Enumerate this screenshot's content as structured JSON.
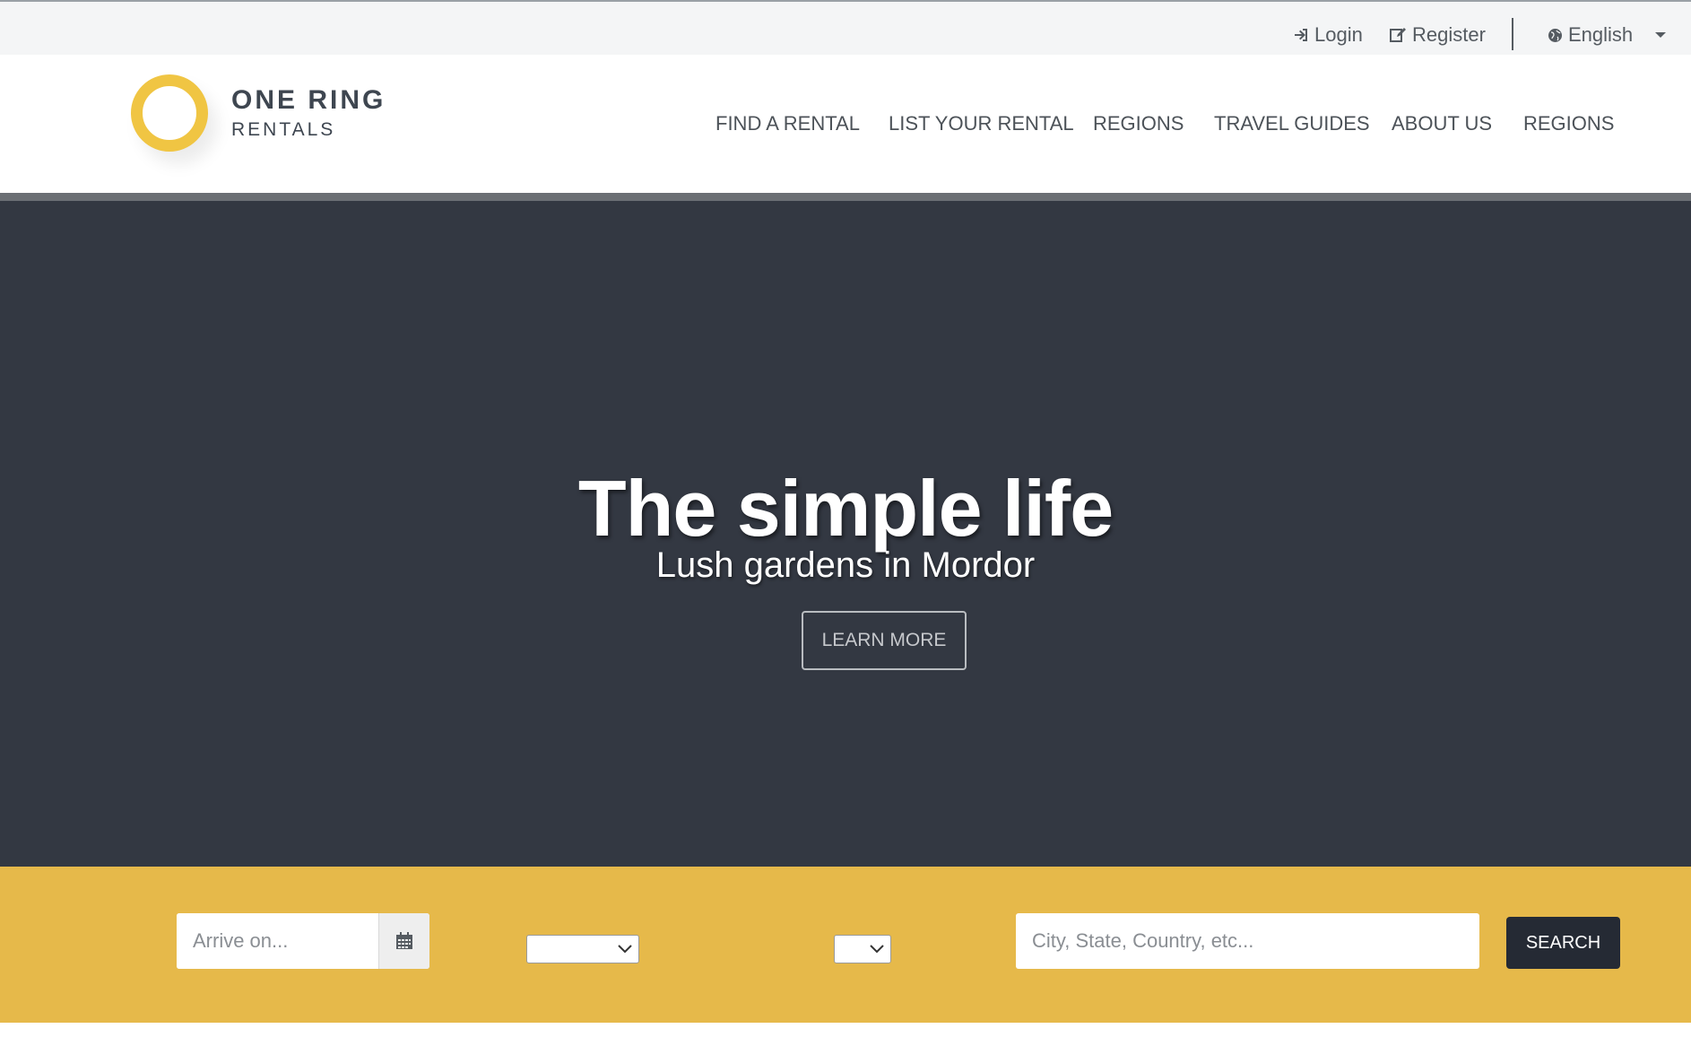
{
  "topbar": {
    "login_label": "Login",
    "register_label": "Register",
    "language_label": "English"
  },
  "logo": {
    "title": "ONE RING",
    "subtitle": "RENTALS"
  },
  "nav": {
    "items": [
      {
        "label": "FIND A RENTAL"
      },
      {
        "label": "LIST YOUR RENTAL"
      },
      {
        "label": "REGIONS"
      },
      {
        "label": "TRAVEL GUIDES"
      },
      {
        "label": "ABOUT US"
      },
      {
        "label": "REGIONS"
      }
    ]
  },
  "hero": {
    "title": "The simple life",
    "subtitle": "Lush gardens in Mordor",
    "button_label": "LEARN MORE"
  },
  "search": {
    "arrive_placeholder": "Arrive on...",
    "location_placeholder": "City, State, Country, etc...",
    "button_label": "SEARCH"
  },
  "colors": {
    "accent": "#e6b94a",
    "hero_bg": "#333842",
    "dark_button": "#252a34"
  },
  "icons": [
    "sign-in-icon",
    "edit-icon",
    "globe-icon",
    "caret-down-icon",
    "search-icon",
    "calendar-icon",
    "chevron-down-icon"
  ]
}
